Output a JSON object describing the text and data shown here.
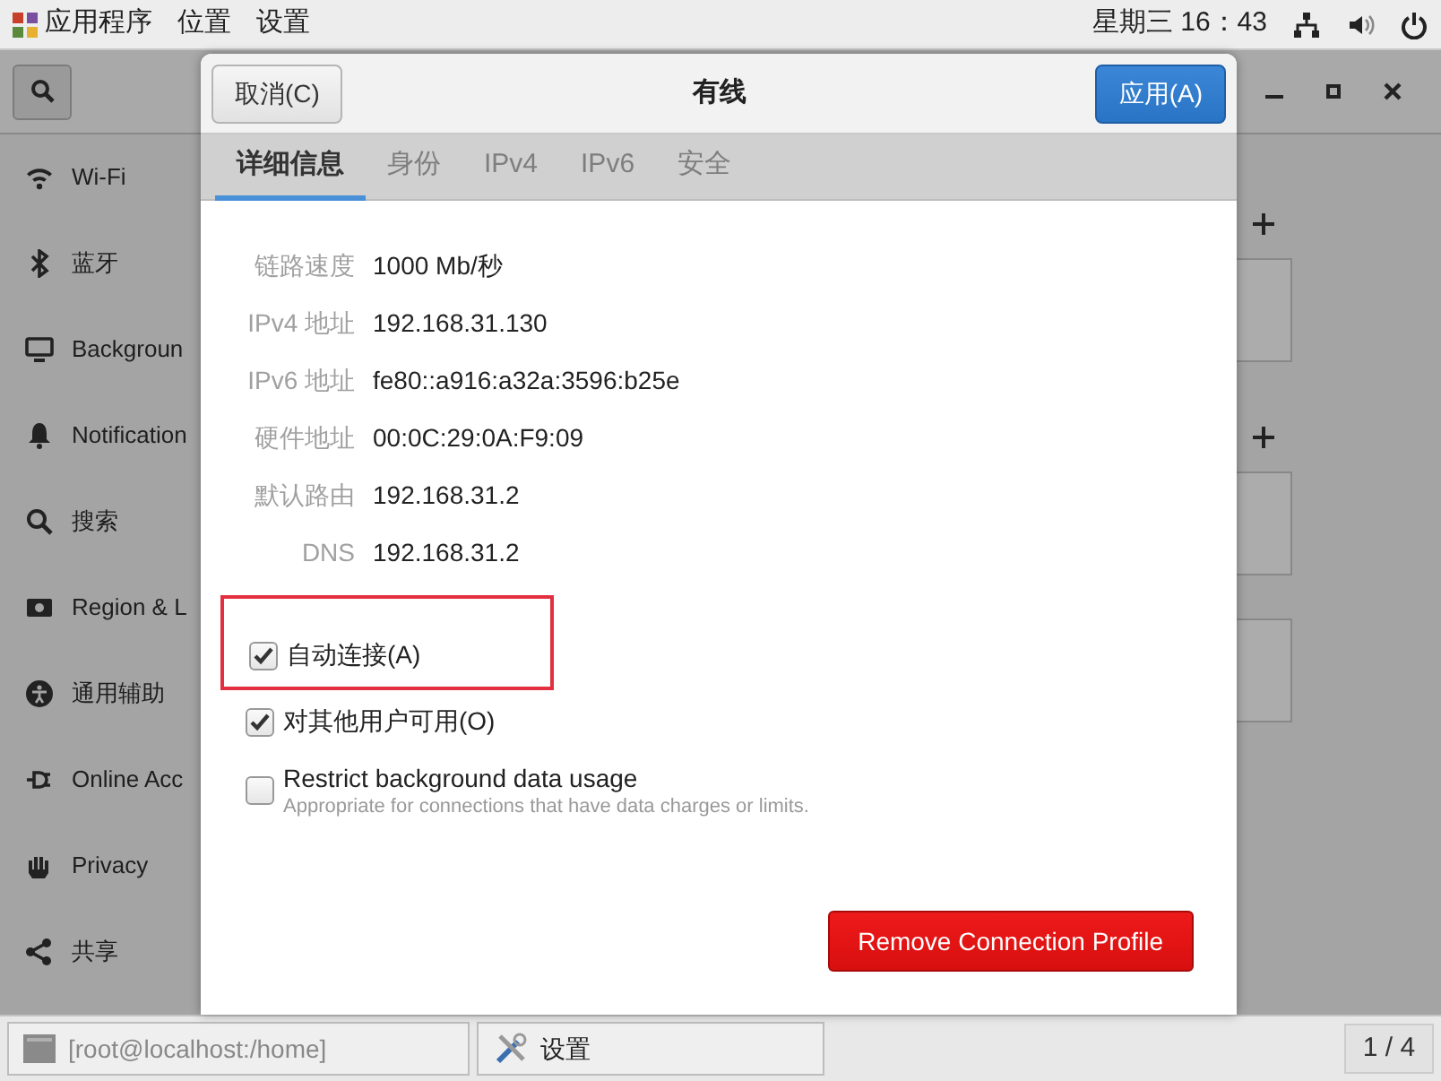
{
  "top_bar": {
    "menus": [
      "应用程序",
      "位置",
      "设置"
    ],
    "clock": "星期三 16：43"
  },
  "settings_window": {
    "sidebar": [
      {
        "label": "Wi-Fi",
        "kind": "wifi"
      },
      {
        "label": "蓝牙",
        "kind": "bluetooth"
      },
      {
        "label": "Backgroun",
        "kind": "background"
      },
      {
        "label": "Notification",
        "kind": "bell"
      },
      {
        "label": "搜索",
        "kind": "search"
      },
      {
        "label": "Region & L",
        "kind": "region"
      },
      {
        "label": "通用辅助",
        "kind": "access"
      },
      {
        "label": "Online Acc",
        "kind": "online"
      },
      {
        "label": "Privacy",
        "kind": "hand"
      },
      {
        "label": "共享",
        "kind": "share"
      }
    ]
  },
  "dialog": {
    "title": "有线",
    "cancel": "取消(C)",
    "apply": "应用(A)",
    "tabs": [
      {
        "label": "详细信息",
        "selected": true
      },
      {
        "label": "身份",
        "selected": false
      },
      {
        "label": "IPv4",
        "selected": false
      },
      {
        "label": "IPv6",
        "selected": false
      },
      {
        "label": "安全",
        "selected": false
      }
    ],
    "details": [
      {
        "label": "链路速度",
        "value": "1000 Mb/秒"
      },
      {
        "label": "IPv4 地址",
        "value": "192.168.31.130"
      },
      {
        "label": "IPv6 地址",
        "value": "fe80::a916:a32a:3596:b25e"
      },
      {
        "label": "硬件地址",
        "value": "00:0C:29:0A:F9:09"
      },
      {
        "label": "默认路由",
        "value": "192.168.31.2"
      },
      {
        "label": "DNS",
        "value": "192.168.31.2"
      }
    ],
    "options": [
      {
        "label": "自动连接(A)",
        "checked": true,
        "highlighted": true
      },
      {
        "label": "对其他用户可用(O)",
        "checked": true,
        "highlighted": false
      },
      {
        "label": "Restrict background data usage",
        "description": "Appropriate for connections that have data charges or limits.",
        "checked": false,
        "highlighted": false
      }
    ],
    "remove": "Remove Connection Profile"
  },
  "taskbar": {
    "windows": [
      {
        "label": "[root@localhost:/home]",
        "kind": "terminal"
      },
      {
        "label": "设置",
        "kind": "settings"
      }
    ],
    "workspace": "1 / 4"
  }
}
